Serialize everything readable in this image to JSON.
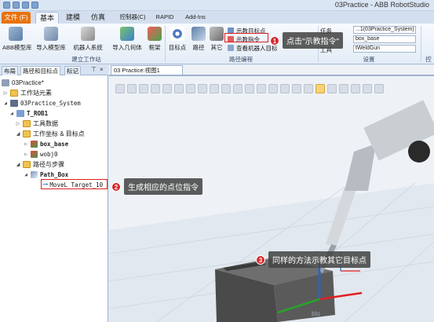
{
  "window": {
    "title": "03Practice - ABB RobotStudio"
  },
  "ribbon_tabs": [
    {
      "label": "文件 (F)"
    },
    {
      "label": "基本"
    },
    {
      "label": "建模"
    },
    {
      "label": "仿真"
    },
    {
      "label": "控制器(C)"
    },
    {
      "label": "RAPID"
    },
    {
      "label": "Add-Ins"
    }
  ],
  "ribbon": {
    "buttons": [
      {
        "label": "ABB模型库"
      },
      {
        "label": "导入模型库"
      },
      {
        "label": "机器人系统"
      },
      {
        "label": "导入几何体"
      },
      {
        "label": "框架"
      },
      {
        "label": "目标点"
      },
      {
        "label": "路径"
      },
      {
        "label": "其它"
      }
    ],
    "small_items": [
      {
        "label": "示教目标点"
      },
      {
        "label": "示教指令"
      },
      {
        "label": "查看机器人目标"
      }
    ],
    "groups": [
      {
        "label": "建立工作站"
      },
      {
        "label": "路径编程"
      },
      {
        "label": "设置"
      },
      {
        "label": "控"
      }
    ],
    "settings": {
      "task_label": "任务",
      "task_value": "...1(03Practice_System)",
      "wobj_value": "box_base",
      "tool_label": "工具",
      "tool_value": "tWeldGun"
    }
  },
  "left_panel": {
    "tabs": [
      {
        "label": "布局"
      },
      {
        "label": "路径和目标点"
      },
      {
        "label": "标记"
      }
    ],
    "tree": [
      {
        "label": "03Practice*"
      },
      {
        "label": "工作站元素"
      },
      {
        "label": "03Practice_System"
      },
      {
        "label": "T_ROB1"
      },
      {
        "label": "工具数据"
      },
      {
        "label": "工作坐标 & 目标点"
      },
      {
        "label": "box_base"
      },
      {
        "label": "wobj0"
      },
      {
        "label": "路径与步骤"
      },
      {
        "label": "Path_Box"
      },
      {
        "label": "MoveL Target_10"
      }
    ]
  },
  "view": {
    "tab_label": "03 Practice:视图1",
    "watermark": "blo"
  },
  "callouts": [
    {
      "num": "1",
      "text": "点击\"示教指令\""
    },
    {
      "num": "2",
      "text": "生成相应的点位指令"
    },
    {
      "num": "3",
      "text": "同样的方法示教其它目标点"
    }
  ],
  "colors": {
    "file_tab": "#e8720c",
    "highlight": "#e02020",
    "callout_badge": "#d8262a"
  }
}
